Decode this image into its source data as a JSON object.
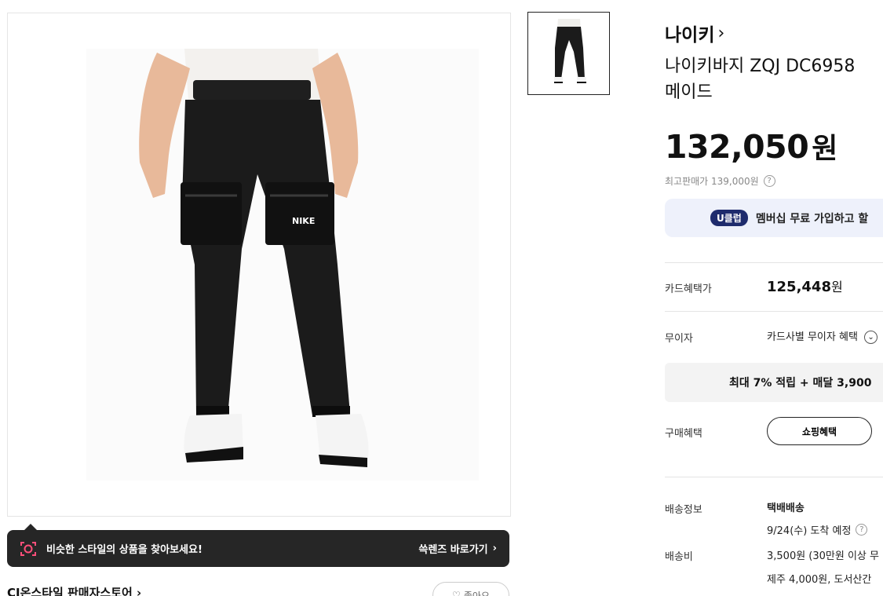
{
  "product": {
    "brand": "나이키",
    "title": "나이키바지 ZQJ DC6958\n메이드",
    "price": "132,050",
    "price_unit": "원",
    "original_price_text": "최고판매가 139,000원"
  },
  "lens_bar": {
    "text": "비슷한 스타일의 상품을 찾아보세요!",
    "link": "쓱렌즈 바로가기"
  },
  "store": {
    "name": "CJ온스타일 판매자스토어",
    "like_label": "좋아요"
  },
  "membership": {
    "badge": "U클럽",
    "text": "멤버십 무료 가입하고 할"
  },
  "benefits": {
    "card_label": "카드혜택가",
    "card_price": "125,448",
    "card_unit": "원",
    "installment_label": "무이자",
    "installment_value": "카드사별 무이자 혜택",
    "points_text": "최대 7% 적립 + 매달 3,900",
    "purchase_label": "구매혜택",
    "shopping_button": "쇼핑혜택"
  },
  "shipping": {
    "info_label": "배송정보",
    "method": "택배배송",
    "eta": "9/24(수) 도착 예정",
    "fee_label": "배송비",
    "fee": "3,500원 (30만원 이상 무",
    "extra": "제주 4,000원, 도서산간"
  },
  "colors": {
    "lens_bar_bg": "#262626",
    "membership_bg": "#eef1fb",
    "uclub_badge": "#1e2b6d"
  }
}
